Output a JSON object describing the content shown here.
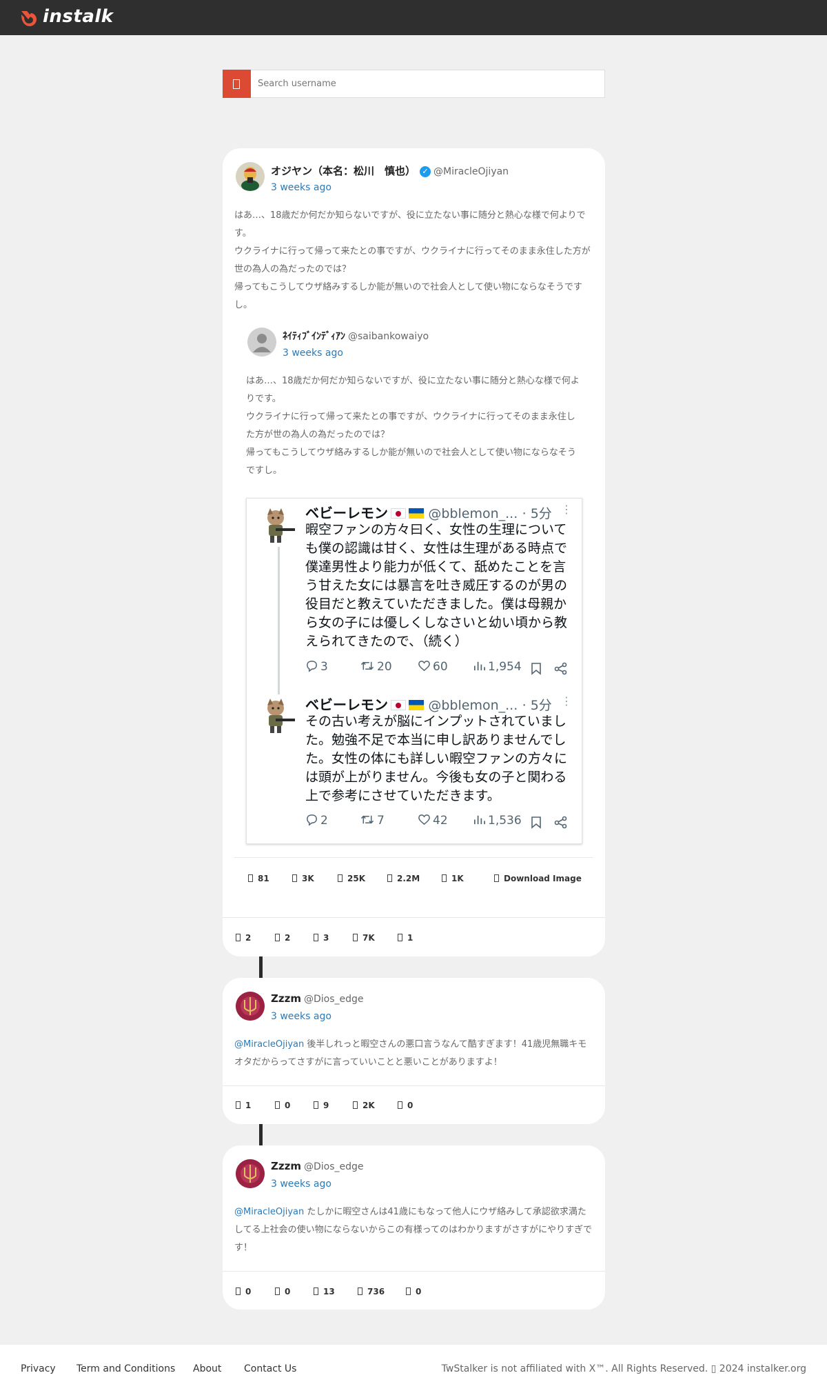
{
  "app": {
    "logo_text": "instalk"
  },
  "search": {
    "placeholder": "Search username"
  },
  "post": {
    "author_name": "オジヤン（本名：松川　慎也）",
    "author_handle": "@MiracleOjiyan",
    "time": "3 weeks ago",
    "text": [
      "はあ…、18歳だか何だか知らないですが、役に立たない事に随分と熱心な様で何よりです。",
      "ウクライナに行って帰って来たとの事ですが、ウクライナに行ってそのまま永住した方が世の為人の為だったのでは？",
      "帰ってもこうしてウザ絡みするしか能が無いので社会人として使い物にならなそうですし。"
    ],
    "quoted": {
      "author_name": "ﾈｲﾃｨﾌﾞｲﾝﾃﾞｨｱﾝ",
      "author_handle": "@saibankowaiyo",
      "time": "3 weeks ago",
      "text": [
        "はあ…、18歳だか何だか知らないですが、役に立たない事に随分と熱心な様で何よりです。",
        "ウクライナに行って帰って来たとの事ですが、ウクライナに行ってそのまま永住した方が世の為人の為だったのでは？",
        "帰ってもこうしてウザ絡みするしか能が無いので社会人として使い物にならなそうですし。"
      ],
      "stats": {
        "replies": "81",
        "retweets": "3K",
        "likes": "25K",
        "views": "2.2M",
        "bookmarks": "1K",
        "download_label": "Download Image"
      }
    },
    "stats": {
      "replies": "2",
      "retweets": "2",
      "likes": "3",
      "views": "7K",
      "bookmarks": "1"
    }
  },
  "embedded_tweets": [
    {
      "name": "ベビーレモン",
      "handle": "@bblemon_...",
      "age": "· 5分",
      "text": "暇空ファンの方々曰く、女性の生理についても僕の認識は甘く、女性は生理がある時点で僕達男性より能力が低くて、舐めたことを言う甘えた女には暴言を吐き威圧するのが男の役目だと教えていただきました。僕は母親から女の子には優しくしなさいと幼い頃から教えられてきたので、（続く）",
      "replies": "3",
      "retweets": "20",
      "likes": "60",
      "views": "1,954"
    },
    {
      "name": "ベビーレモン",
      "handle": "@bblemon_...",
      "age": "· 5分",
      "text": "その古い考えが脳にインプットされていました。勉強不足で本当に申し訳ありませんでした。女性の体にも詳しい暇空ファンの方々には頭が上がりません。今後も女の子と関わる上で参考にさせていただきます。",
      "replies": "2",
      "retweets": "7",
      "likes": "42",
      "views": "1,536"
    }
  ],
  "replies": [
    {
      "author_name": "Zzzm",
      "author_handle": "@Dios_edge",
      "time": "3 weeks ago",
      "mention": "@MiracleOjiyan",
      "text": " 後半しれっと暇空さんの悪口言うなんて酷すぎます！41歳児無職キモオタだからってさすがに言っていいことと悪いことがありますよ！",
      "stats": {
        "replies": "1",
        "retweets": "0",
        "likes": "9",
        "views": "2K",
        "bookmarks": "0"
      }
    },
    {
      "author_name": "Zzzm",
      "author_handle": "@Dios_edge",
      "time": "3 weeks ago",
      "mention": "@MiracleOjiyan",
      "text": " たしかに暇空さんは41歳にもなって他人にウザ絡みして承認欲求満たしてる上社会の使い物にならないからこの有様ってのはわかりますがさすがにやりすぎです！",
      "stats": {
        "replies": "0",
        "retweets": "0",
        "likes": "13",
        "views": "736",
        "bookmarks": "0"
      }
    }
  ],
  "footer": {
    "links": [
      "Privacy",
      "Term and Conditions",
      "About",
      "Contact Us"
    ],
    "copyright": "TwStalker is not affiliated with X™. All Rights Reserved. ▯ 2024 instalker.org"
  },
  "colors": {
    "topbar": "#2f2f2f",
    "accent": "#dd4a34",
    "link": "#2a7ab8",
    "verified": "#1d9bf0"
  },
  "icons": [
    "instalk-logo-icon",
    "search-icon",
    "verified-badge-icon",
    "reply-icon",
    "retweet-icon",
    "like-icon",
    "views-icon",
    "bookmark-icon",
    "share-icon",
    "more-icon",
    "download-icon"
  ]
}
